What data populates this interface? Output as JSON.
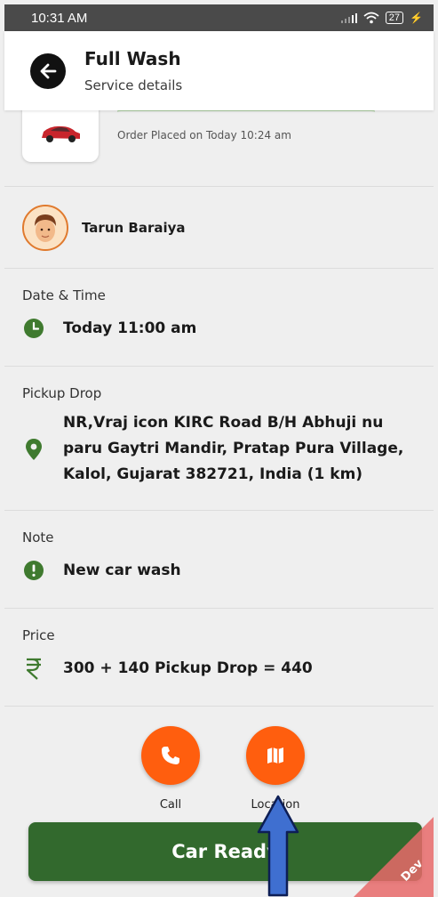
{
  "status_bar": {
    "time": "10:31 AM",
    "battery": "27"
  },
  "header": {
    "title": "Full Wash",
    "subtitle": "Service details"
  },
  "order": {
    "placed_text": "Order Placed on Today 10:24 am"
  },
  "customer": {
    "name": "Tarun Baraiya"
  },
  "date_time": {
    "label": "Date & Time",
    "value": "Today 11:00 am"
  },
  "pickup": {
    "label": "Pickup Drop",
    "address": "NR,Vraj icon KIRC Road B/H Abhuji nu paru Gaytri Mandir, Pratap Pura Village, Kalol, Gujarat 382721, India  (1 km)"
  },
  "note": {
    "label": "Note",
    "value": "New car wash"
  },
  "price": {
    "label": "Price",
    "value": "300 + 140 Pickup Drop = 440",
    "currency_icon": "rupee-icon"
  },
  "actions": {
    "call_label": "Call",
    "location_label": "Location"
  },
  "primary_button": {
    "label": "Car Ready"
  },
  "debug_banner": {
    "label": "Dev"
  },
  "colors": {
    "accent_orange": "#ff5e0e",
    "primary_green": "#32692d",
    "icon_green": "#3f7a2f",
    "annotation_arrow": "#3f6fd0"
  }
}
